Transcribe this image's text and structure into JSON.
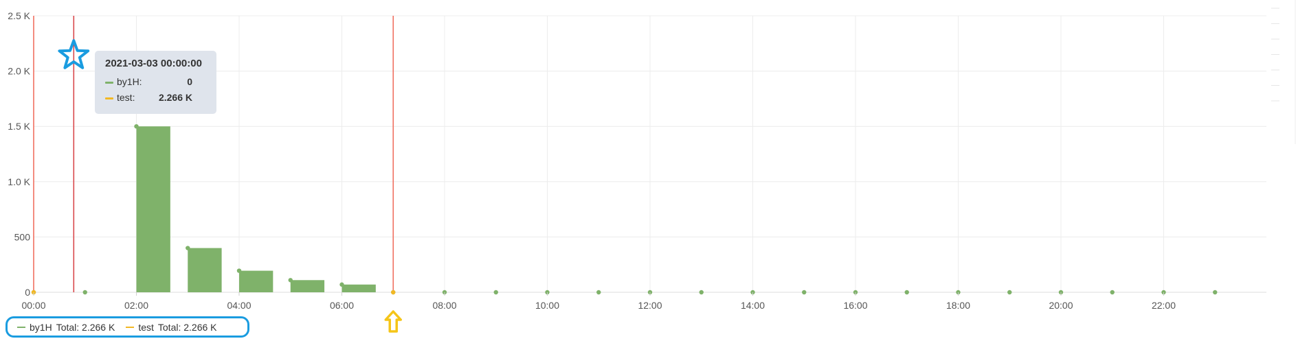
{
  "chart_data": {
    "type": "bar",
    "x_unit": "hour of day",
    "xlim": [
      0,
      24
    ],
    "ylim": [
      0,
      2500
    ],
    "y_ticks": [
      0,
      500,
      1000,
      1500,
      2000,
      2500
    ],
    "y_tick_labels": [
      "0",
      "500",
      "1.0 K",
      "1.5 K",
      "2.0 K",
      "2.5 K"
    ],
    "x_ticks": [
      0,
      2,
      4,
      6,
      8,
      10,
      12,
      14,
      16,
      18,
      20,
      22
    ],
    "x_tick_labels": [
      "00:00",
      "02:00",
      "04:00",
      "06:00",
      "08:00",
      "10:00",
      "12:00",
      "14:00",
      "16:00",
      "18:00",
      "20:00",
      "22:00"
    ],
    "grid": true,
    "series": [
      {
        "name": "by1H",
        "color": "#7fb26a",
        "x": [
          0,
          1,
          2,
          3,
          4,
          5,
          6,
          7,
          8,
          9,
          10,
          11,
          12,
          13,
          14,
          15,
          16,
          17,
          18,
          19,
          20,
          21,
          22,
          23
        ],
        "values": [
          0,
          0,
          1500,
          400,
          195,
          110,
          70,
          0,
          0,
          0,
          0,
          0,
          0,
          0,
          0,
          0,
          0,
          0,
          0,
          0,
          0,
          0,
          0,
          0
        ]
      },
      {
        "name": "test",
        "color": "#f2b824",
        "x": [
          0,
          7
        ],
        "values": [
          0,
          0
        ]
      }
    ],
    "markers": [
      {
        "x": 0,
        "color": "#f07060"
      },
      {
        "x": 0.78,
        "color": "#d9484c"
      },
      {
        "x": 7,
        "color": "#f07060"
      }
    ],
    "legend_position": "bottom-left",
    "legend": [
      {
        "name": "by1H",
        "total_label": "Total: 2.266 K",
        "color": "#7fb26a"
      },
      {
        "name": "test",
        "total_label": "Total: 2.266 K",
        "color": "#f2b824"
      }
    ]
  },
  "tooltip": {
    "title": "2021-03-03 00:00:00",
    "rows": [
      {
        "name": "by1H:",
        "value": "0",
        "color": "#7fb26a"
      },
      {
        "name": "test:",
        "value": "2.266 K",
        "color": "#f2b824"
      }
    ]
  },
  "annotations": {
    "highlight_color": "#1a9ce0",
    "arrow_color": "#f5c518",
    "icons": [
      "star-icon",
      "arrow-up-icon"
    ]
  }
}
